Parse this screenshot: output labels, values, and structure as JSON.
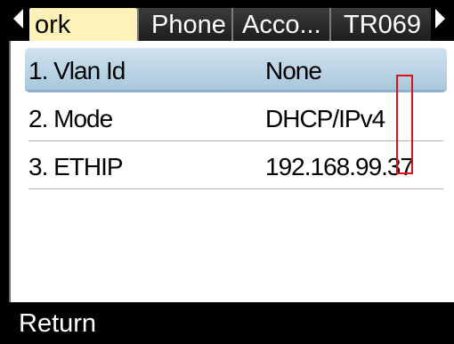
{
  "tabs": [
    {
      "label": "ork",
      "active": true
    },
    {
      "label": "Phone",
      "active": false
    },
    {
      "label": "Acco...",
      "active": false
    },
    {
      "label": "TR069",
      "active": false
    }
  ],
  "rows": [
    {
      "label": "1. Vlan Id",
      "value": "None",
      "selected": true
    },
    {
      "label": "2. Mode",
      "value": "DHCP/IPv4",
      "selected": false
    },
    {
      "label": "3. ETHIP",
      "value": "192.168.99.37",
      "selected": false
    }
  ],
  "footer": {
    "return_label": "Return"
  },
  "colors": {
    "active_tab": "#fff2b8",
    "selected_row": "#a9c8dc",
    "highlight_box": "#e0101a"
  }
}
